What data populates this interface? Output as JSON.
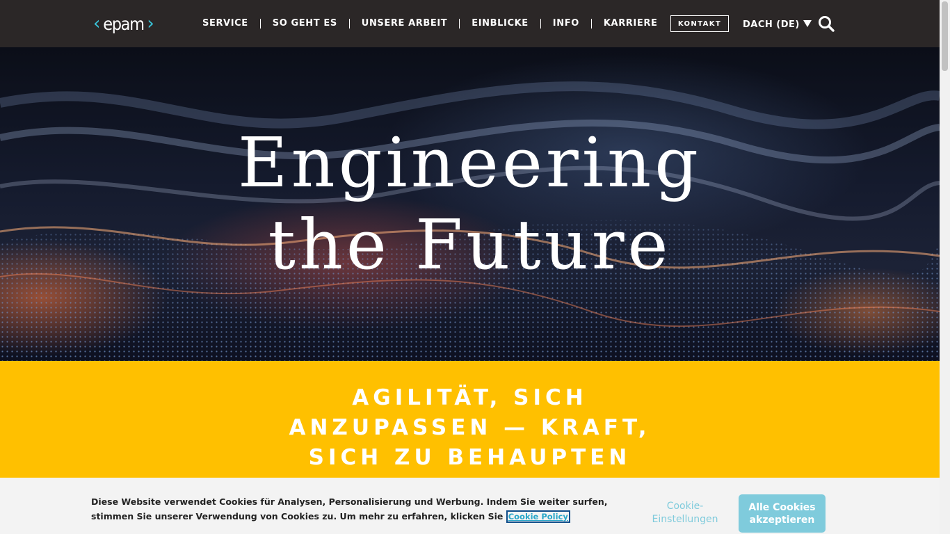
{
  "header": {
    "logo_text": "epam",
    "nav": [
      {
        "label": "SERVICE"
      },
      {
        "label": "SO GEHT ES"
      },
      {
        "label": "UNSERE ARBEIT"
      },
      {
        "label": "EINBLICKE"
      },
      {
        "label": "INFO"
      },
      {
        "label": "KARRIERE"
      }
    ],
    "contact_label": "KONTAKT",
    "region_label": "DACH (DE)",
    "search_icon": "search-icon"
  },
  "hero": {
    "title_line1": "Engineering",
    "title_line2": "the Future"
  },
  "band": {
    "line1": "AGILITÄT, SICH",
    "line2": "ANZUPASSEN — KRAFT,",
    "line3": "SICH ZU BEHAUPTEN"
  },
  "cookie": {
    "message_line1": "Diese Website verwendet Cookies für Analysen, Personalisierung und Werbung. Indem Sie weiter surfen,",
    "message_line2": "stimmen Sie unserer Verwendung von Cookies zu. Um mehr zu erfahren, klicken Sie",
    "policy_link": "Cookie Policy",
    "settings_line1": "Cookie-",
    "settings_line2": "Einstellungen",
    "accept_line1": "Alle Cookies",
    "accept_line2": "akzeptieren"
  },
  "colors": {
    "header_bg": "#2b2727",
    "logo_accent": "#39c2d7",
    "band_yellow": "#ffc000",
    "cookie_button": "#7fcbdc"
  }
}
